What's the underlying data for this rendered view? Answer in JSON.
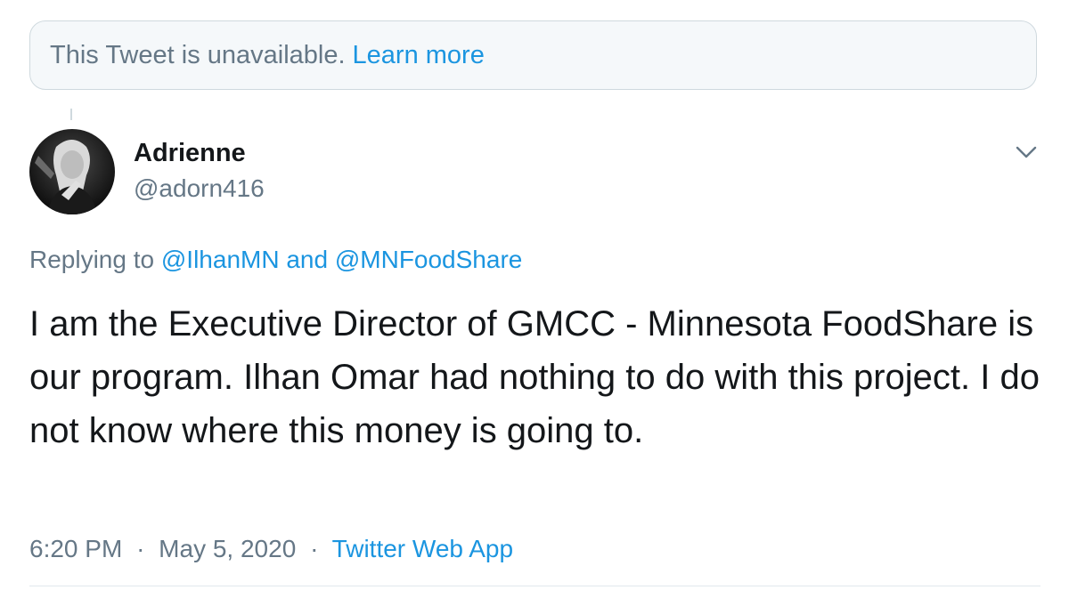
{
  "unavailable_notice": {
    "text": "This Tweet is unavailable.",
    "link_label": "Learn more"
  },
  "tweet": {
    "author": {
      "display_name": "Adrienne",
      "handle": "@adorn416",
      "avatar_icon": "user-avatar-photo"
    },
    "replying_to": {
      "prefix": "Replying to",
      "mention_1": "@IlhanMN",
      "conjunction": "and",
      "mention_2": "@MNFoodShare"
    },
    "text": "I am the Executive Director of GMCC - Minnesota FoodShare is our program. Ilhan Omar had nothing to do with this project. I do not know where this money is going to.",
    "time": "6:20 PM",
    "separator": "·",
    "date": "May 5, 2020",
    "source": "Twitter Web App",
    "menu_icon": "chevron-down-icon"
  },
  "colors": {
    "link": "#1b95e0",
    "secondary_text": "#657786",
    "primary_text": "#14171a",
    "border": "#cfd9de",
    "notice_background": "#f5f8fa"
  }
}
